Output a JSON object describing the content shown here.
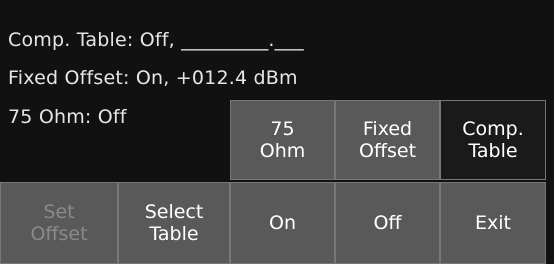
{
  "status": {
    "comp_table": "Comp. Table:  Off, _________.___",
    "fixed_offset": "Fixed Offset:  On, +012.4 dBm",
    "ohm75": "75 Ohm: Off"
  },
  "upper_buttons": {
    "ohm75": "75\nOhm",
    "fixed_offset": "Fixed\nOffset",
    "comp_table": "Comp.\nTable"
  },
  "lower_buttons": {
    "set_offset": "Set\nOffset",
    "select_table": "Select\nTable",
    "on": "On",
    "off": "Off",
    "exit": "Exit"
  },
  "colors": {
    "panel_bg": "#111111",
    "button_bg": "#595959",
    "selected_button_bg": "#1a1a1a",
    "text": "#ffffff",
    "disabled_text": "#8a8a8a"
  }
}
